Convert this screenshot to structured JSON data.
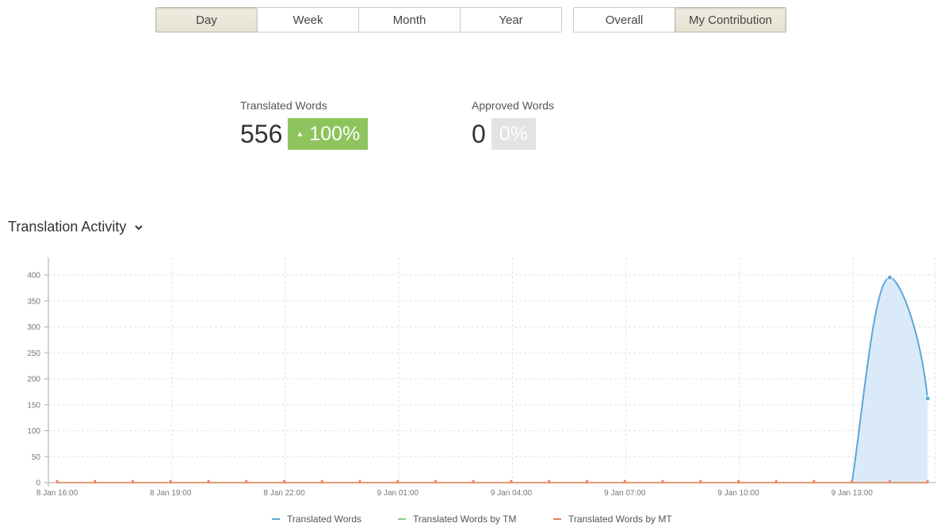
{
  "period_tabs": [
    {
      "label": "Day",
      "active": true
    },
    {
      "label": "Week",
      "active": false
    },
    {
      "label": "Month",
      "active": false
    },
    {
      "label": "Year",
      "active": false
    }
  ],
  "scope_tabs": [
    {
      "label": "Overall",
      "active": false
    },
    {
      "label": "My Contribution",
      "active": true
    }
  ],
  "stats": {
    "translated": {
      "label": "Translated Words",
      "value": "556",
      "change": "100%",
      "trend": "up",
      "color": "#8dc45e"
    },
    "approved": {
      "label": "Approved Words",
      "value": "0",
      "change": "0%",
      "color": "#e3e3e3"
    }
  },
  "activity": {
    "title": "Translation Activity"
  },
  "chart_data": {
    "type": "area",
    "x": [
      "8 Jan 16:00",
      "8 Jan 17:00",
      "8 Jan 18:00",
      "8 Jan 19:00",
      "8 Jan 20:00",
      "8 Jan 21:00",
      "8 Jan 22:00",
      "8 Jan 23:00",
      "9 Jan 00:00",
      "9 Jan 01:00",
      "9 Jan 02:00",
      "9 Jan 03:00",
      "9 Jan 04:00",
      "9 Jan 05:00",
      "9 Jan 06:00",
      "9 Jan 07:00",
      "9 Jan 08:00",
      "9 Jan 09:00",
      "9 Jan 10:00",
      "9 Jan 11:00",
      "9 Jan 12:00",
      "9 Jan 13:00",
      "9 Jan 14:00",
      "9 Jan 15:00"
    ],
    "x_tick_labels": [
      "8 Jan 16:00",
      "8 Jan 19:00",
      "8 Jan 22:00",
      "9 Jan 01:00",
      "9 Jan 04:00",
      "9 Jan 07:00",
      "9 Jan 10:00",
      "9 Jan 13:00"
    ],
    "ylim": [
      0,
      420
    ],
    "y_ticks": [
      0,
      50,
      100,
      150,
      200,
      250,
      300,
      350,
      400
    ],
    "grid": true,
    "legend_position": "bottom",
    "series": [
      {
        "name": "Translated Words",
        "color": "#5aa8d8",
        "values": [
          0,
          0,
          0,
          0,
          0,
          0,
          0,
          0,
          0,
          0,
          0,
          0,
          0,
          0,
          0,
          0,
          0,
          0,
          0,
          0,
          0,
          0,
          395,
          162
        ]
      },
      {
        "name": "Translated Words by TM",
        "color": "#8dc98a",
        "values": [
          0,
          0,
          0,
          0,
          0,
          0,
          0,
          0,
          0,
          0,
          0,
          0,
          0,
          0,
          0,
          0,
          0,
          0,
          0,
          0,
          0,
          0,
          0,
          0
        ]
      },
      {
        "name": "Translated Words by MT",
        "color": "#e9825b",
        "values": [
          0,
          0,
          0,
          0,
          0,
          0,
          0,
          0,
          0,
          0,
          0,
          0,
          0,
          0,
          0,
          0,
          0,
          0,
          0,
          0,
          0,
          0,
          0,
          0
        ]
      }
    ]
  }
}
